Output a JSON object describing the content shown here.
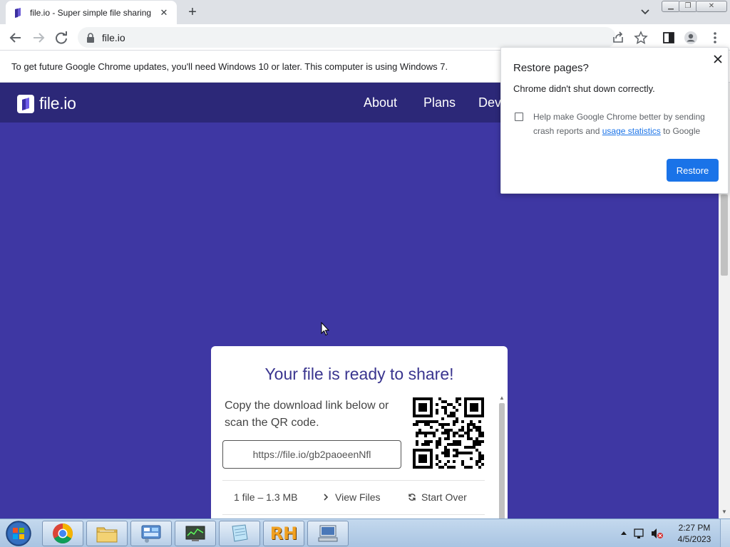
{
  "browser": {
    "tab_title": "file.io - Super simple file sharing",
    "url": "file.io",
    "infobar_message": "To get future Google Chrome updates, you'll need Windows 10 or later. This computer is using Windows 7."
  },
  "site": {
    "logo_text": "file.io",
    "nav": [
      "About",
      "Plans",
      "Dev"
    ]
  },
  "card": {
    "heading": "Your file is ready to share!",
    "description": "Copy the download link below or scan the QR code.",
    "link_value": "https://file.io/gb2paoeenNfl",
    "file_info": "1 file – 1.3 MB",
    "view_files": "View Files",
    "start_over": "Start Over"
  },
  "restore_dialog": {
    "title": "Restore pages?",
    "message": "Chrome didn't shut down correctly.",
    "checkbox_line1": "Help make Google Chrome better by sending",
    "checkbox_line2_prefix": "crash reports and",
    "checkbox_link": "usage statistics",
    "checkbox_line2_suffix": "to Google",
    "button": "Restore"
  },
  "taskbar": {
    "time": "2:27 PM",
    "date": "4/5/2023",
    "rh_label": "RH"
  },
  "colors": {
    "page_bg": "#3e37a3",
    "navbar_bg": "#2c2878",
    "accent_blue": "#1a73e8"
  }
}
